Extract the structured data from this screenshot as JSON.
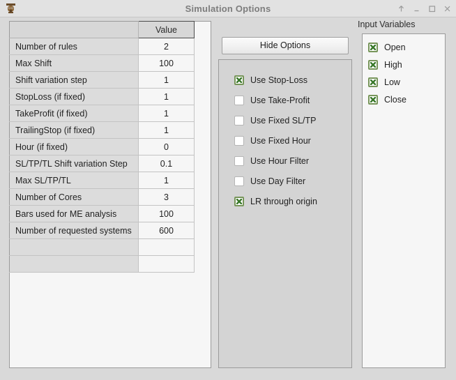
{
  "window": {
    "title": "Simulation Options",
    "icon": "app-icon",
    "controls": [
      {
        "name": "shade-button",
        "glyph": "up-arrow-icon"
      },
      {
        "name": "minimize-button",
        "glyph": "minimize-icon"
      },
      {
        "name": "maximize-button",
        "glyph": "maximize-icon"
      },
      {
        "name": "close-button",
        "glyph": "close-icon"
      }
    ]
  },
  "options_table": {
    "headers": [
      "",
      "Value"
    ],
    "rows": [
      {
        "label": "Number of rules",
        "value": "2"
      },
      {
        "label": "Max Shift",
        "value": "100"
      },
      {
        "label": "Shift variation step",
        "value": "1"
      },
      {
        "label": "StopLoss (if fixed)",
        "value": "1"
      },
      {
        "label": "TakeProfit (if fixed)",
        "value": "1"
      },
      {
        "label": "TrailingStop (if fixed)",
        "value": "1"
      },
      {
        "label": "Hour (if fixed)",
        "value": "0"
      },
      {
        "label": "SL/TP/TL Shift variation Step",
        "value": "0.1"
      },
      {
        "label": "Max SL/TP/TL",
        "value": "1"
      },
      {
        "label": "Number of Cores",
        "value": "3"
      },
      {
        "label": "Bars used for ME analysis",
        "value": "100"
      },
      {
        "label": "Number of requested systems",
        "value": "600"
      },
      {
        "label": "",
        "value": ""
      },
      {
        "label": "",
        "value": ""
      }
    ]
  },
  "middle": {
    "hide_options_label": "Hide Options",
    "checkboxes": [
      {
        "label": "Use Stop-Loss",
        "checked": true
      },
      {
        "label": "Use Take-Profit",
        "checked": false
      },
      {
        "label": "Use Fixed SL/TP",
        "checked": false
      },
      {
        "label": "Use Fixed Hour",
        "checked": false
      },
      {
        "label": "Use Hour Filter",
        "checked": false
      },
      {
        "label": "Use Day Filter",
        "checked": false
      },
      {
        "label": "LR through origin",
        "checked": true
      }
    ]
  },
  "input_variables": {
    "title": "Input Variables",
    "items": [
      {
        "label": "Open",
        "checked": true
      },
      {
        "label": "High",
        "checked": true
      },
      {
        "label": "Low",
        "checked": true
      },
      {
        "label": "Close",
        "checked": true
      }
    ]
  },
  "colors": {
    "window_bg": "#d9d9d9",
    "titlebar_bg": "#e2e2e2",
    "title_fg": "#7d7d7d",
    "panel_bg": "#f6f6f6",
    "mid_panel_bg": "#d4d4d4",
    "row_label_bg": "#dcdcdc",
    "check_border": "#77955a",
    "check_mark": "#3c7a2d"
  }
}
